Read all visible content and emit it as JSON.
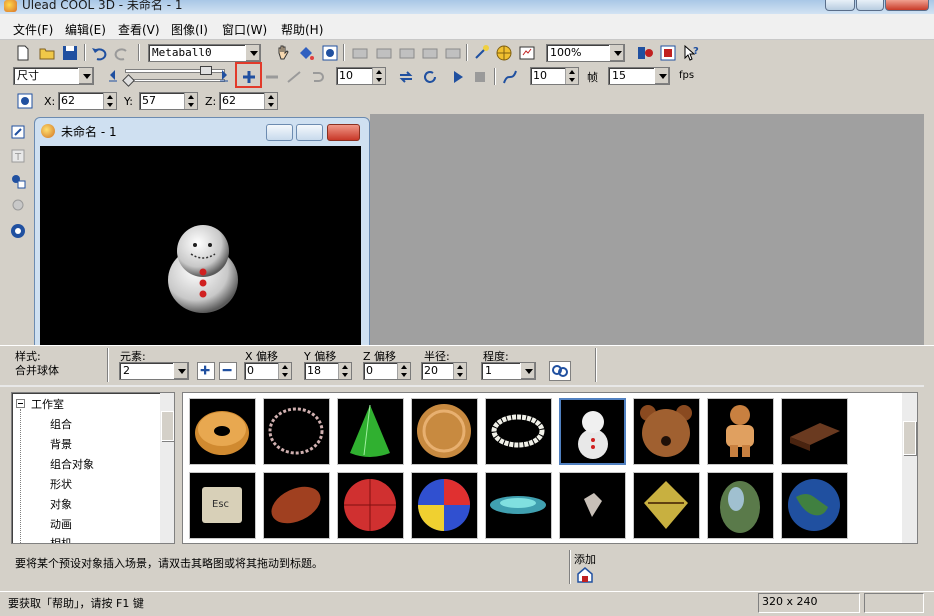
{
  "window": {
    "title": "Ulead COOL 3D - 未命名 - 1"
  },
  "menu": [
    {
      "label": "文件(F)"
    },
    {
      "label": "编辑(E)"
    },
    {
      "label": "查看(V)"
    },
    {
      "label": "图像(I)"
    },
    {
      "label": "窗口(W)"
    },
    {
      "label": "帮助(H)"
    }
  ],
  "toolbar1": {
    "object_combo": "Metaball0",
    "zoom_combo": "100%"
  },
  "toolbar2": {
    "size_combo": "尺寸",
    "frame_value": "10",
    "step_value": "10",
    "frame_label": "帧",
    "fps_combo": "15",
    "fps_label": "fps"
  },
  "toolbar3": {
    "x_label": "X:",
    "x_value": "62",
    "y_label": "Y:",
    "y_value": "57",
    "z_label": "Z:",
    "z_value": "62"
  },
  "document": {
    "title": "未命名 - 1"
  },
  "props": {
    "style_label": "样式:",
    "style_value": "合并球体",
    "element_label": "元素:",
    "element_value": "2",
    "xoff_label": "X 偏移",
    "xoff_value": "0",
    "yoff_label": "Y 偏移",
    "yoff_value": "18",
    "zoff_label": "Z 偏移",
    "zoff_value": "0",
    "radius_label": "半径:",
    "radius_value": "20",
    "degree_label": "程度:",
    "degree_value": "1"
  },
  "tree": {
    "root": "工作室",
    "items": [
      "组合",
      "背景",
      "组合对象",
      "形状",
      "对象",
      "动画",
      "相机"
    ]
  },
  "thumbs": [
    {
      "icon": "donut-icon"
    },
    {
      "icon": "ring-icon"
    },
    {
      "icon": "cone-icon"
    },
    {
      "icon": "cookie-icon"
    },
    {
      "icon": "pearl-necklace-icon"
    },
    {
      "icon": "snowman-icon"
    },
    {
      "icon": "bear-icon"
    },
    {
      "icon": "gingerbread-icon"
    },
    {
      "icon": "chocolate-icon"
    },
    {
      "icon": "esc-key-icon"
    },
    {
      "icon": "football-icon"
    },
    {
      "icon": "basketball-icon"
    },
    {
      "icon": "beach-ball-icon"
    },
    {
      "icon": "disc-icon"
    },
    {
      "icon": "gem-icon"
    },
    {
      "icon": "mask-icon"
    },
    {
      "icon": "egg-icon"
    },
    {
      "icon": "earth-icon"
    }
  ],
  "hint": {
    "text": "要将某个预设对象插入场景，请双击其略图或将其拖动到标题。",
    "add_label": "添加"
  },
  "status": {
    "help_text": "要获取「帮助」，请按 F1 键",
    "size_text": "320 x 240"
  },
  "colors": {
    "highlight": "#e23a2a",
    "canvas": "#000000",
    "workspace": "#a0a0a0",
    "selection": "#5080c0"
  }
}
